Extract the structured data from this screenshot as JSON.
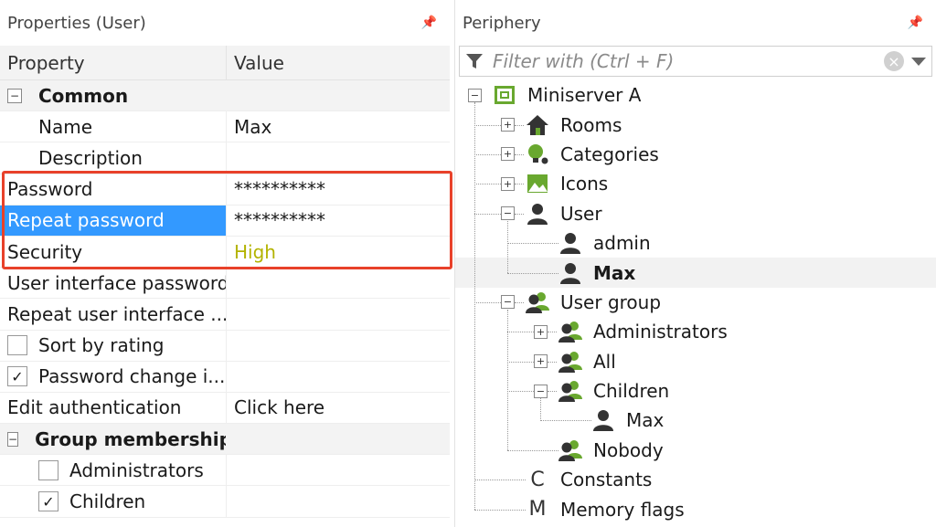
{
  "left_panel": {
    "title": "Properties (User)",
    "pin_icon": "📌",
    "header": {
      "property": "Property",
      "value": "Value"
    },
    "rows": [
      {
        "kind": "category",
        "label": "Common",
        "expander": "−"
      },
      {
        "kind": "prop",
        "label": "Name",
        "value": "Max",
        "level": 1
      },
      {
        "kind": "prop",
        "label": "Description",
        "value": "",
        "level": 1
      },
      {
        "kind": "prop",
        "label": "Password",
        "value": "**********",
        "level": 0
      },
      {
        "kind": "prop",
        "label": "Repeat password",
        "value": "**********",
        "level": 0,
        "selected": true
      },
      {
        "kind": "prop",
        "label": "Security",
        "value": "High",
        "level": 0,
        "valueClass": "security-high"
      },
      {
        "kind": "prop",
        "label": "User interface password",
        "value": "",
        "level": 0
      },
      {
        "kind": "prop",
        "label": "Repeat user interface ...",
        "value": "",
        "level": 0
      },
      {
        "kind": "check",
        "label": "Sort by rating",
        "checked": false,
        "level": 0
      },
      {
        "kind": "check",
        "label": "Password change i...",
        "checked": true,
        "level": 0
      },
      {
        "kind": "prop",
        "label": "Edit authentication",
        "value": "Click here",
        "level": 0
      },
      {
        "kind": "category",
        "label": "Group membership",
        "expander": "−"
      },
      {
        "kind": "check",
        "label": "Administrators",
        "checked": false,
        "level": 1
      },
      {
        "kind": "check",
        "label": "Children",
        "checked": true,
        "level": 1
      }
    ],
    "check_mark": "✓"
  },
  "right_panel": {
    "title": "Periphery",
    "filter": {
      "placeholder": "Filter with (Ctrl + F)",
      "value": ""
    },
    "clear_icon": "×",
    "tree": [
      {
        "label": "Miniserver A",
        "depth": 0,
        "expander": "−",
        "icon": "miniserver-icon"
      },
      {
        "label": "Rooms",
        "depth": 1,
        "expander": "+",
        "icon": "house-icon"
      },
      {
        "label": "Categories",
        "depth": 1,
        "expander": "+",
        "icon": "bulb-icon"
      },
      {
        "label": "Icons",
        "depth": 1,
        "expander": "+",
        "icon": "picture-icon"
      },
      {
        "label": "User",
        "depth": 1,
        "expander": "−",
        "icon": "user-icon"
      },
      {
        "label": "admin",
        "depth": 2,
        "expander": "",
        "icon": "user-icon"
      },
      {
        "label": "Max",
        "depth": 2,
        "expander": "",
        "icon": "user-icon",
        "current": true
      },
      {
        "label": "User group",
        "depth": 1,
        "expander": "−",
        "icon": "group-icon"
      },
      {
        "label": "Administrators",
        "depth": 2,
        "expander": "+",
        "icon": "group-icon"
      },
      {
        "label": "All",
        "depth": 2,
        "expander": "+",
        "icon": "group-icon"
      },
      {
        "label": "Children",
        "depth": 2,
        "expander": "−",
        "icon": "group-icon"
      },
      {
        "label": "Max",
        "depth": 3,
        "expander": "",
        "icon": "user-icon"
      },
      {
        "label": "Nobody",
        "depth": 2,
        "expander": "",
        "icon": "group-icon"
      },
      {
        "label": "Constants",
        "depth": 1,
        "expander": "",
        "icon": "letter-icon",
        "letter": "C"
      },
      {
        "label": "Memory flags",
        "depth": 1,
        "expander": "",
        "icon": "letter-icon",
        "letter": "M"
      }
    ]
  },
  "colors": {
    "selection": "#3399ff",
    "highlight_border": "#e8412a",
    "security_high": "#b3b300",
    "loxone_green": "#69a82f"
  }
}
